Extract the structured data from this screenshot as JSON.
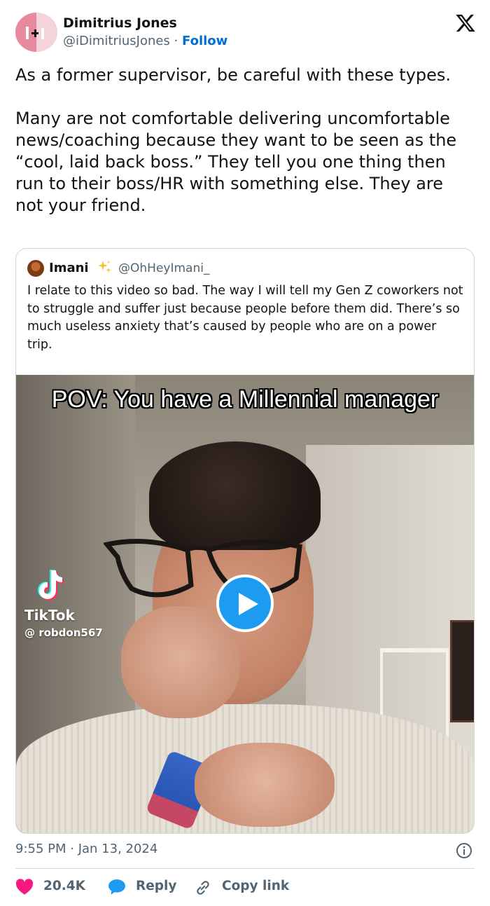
{
  "post": {
    "author": {
      "display_name": "Dimitrius Jones",
      "handle": "@iDimitriusJones",
      "separator": "·",
      "follow_label": "Follow"
    },
    "platform_icon": "x-logo-icon",
    "text": "As a former supervisor, be careful with these types.\n\nMany are not comfortable delivering uncomfortable news/coaching because they want to be seen as the “cool, laid back boss.” They tell you one thing then run to their boss/HR with something else. They are not your friend.",
    "timestamp": "9:55 PM · Jan 13, 2024"
  },
  "quoted_post": {
    "author": {
      "display_name": "Imani",
      "badge_icon": "sparkles-icon",
      "handle": "@OhHeyImani_"
    },
    "text": "I relate to this video so bad. The way I will tell my Gen Z coworkers not to struggle and suffer just because people before them did. There’s so much useless anxiety that’s caused by people who are on a power trip.",
    "video": {
      "overlay_caption": "POV: You have a Millennial manager",
      "watermark_brand": "TikTok",
      "watermark_user": "@ robdon567",
      "play_icon": "play-icon"
    }
  },
  "actions": {
    "like_count": "20.4K",
    "reply_label": "Reply",
    "copy_link_label": "Copy link"
  },
  "colors": {
    "link": "#006fd6",
    "play_button": "#1d9bf0",
    "like_heart": "#f91880",
    "reply_bubble": "#1d9bf0",
    "secondary_text": "#536471",
    "border": "#cfd9de"
  }
}
